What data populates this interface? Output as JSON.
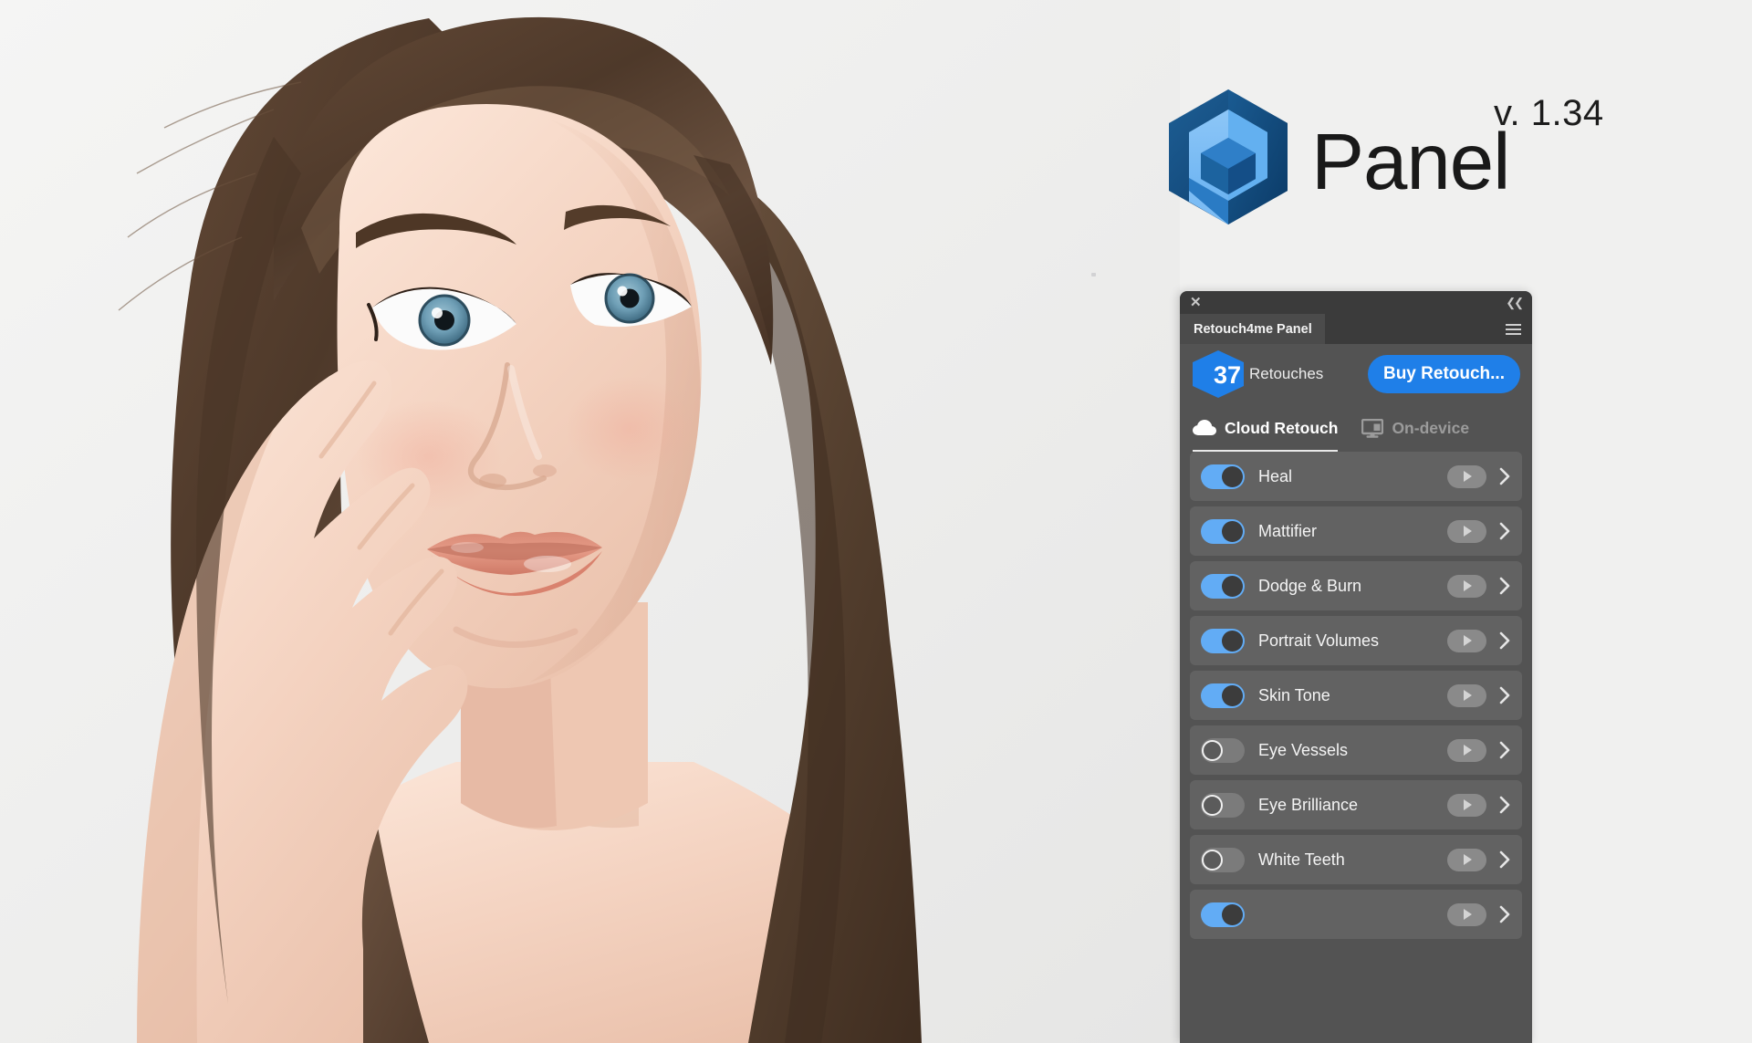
{
  "brand": {
    "name": "Panel",
    "version": "v. 1.34",
    "logo_icon": "hexagon-p-logo-icon"
  },
  "photo": {
    "alt": "portrait-photo-woman-retouched",
    "background_color": "#eeeeee"
  },
  "panel": {
    "titlebar": {
      "close_icon": "close-icon",
      "collapse_icon": "double-chevron-left-icon"
    },
    "tab": {
      "label": "Retouch4me Panel",
      "menu_icon": "hamburger-menu-icon"
    },
    "credits": {
      "count": "37",
      "label": "Retouches",
      "buy_button": "Buy Retouch..."
    },
    "mode_tabs": [
      {
        "label": "Cloud Retouch",
        "icon": "cloud-icon",
        "active": true
      },
      {
        "label": "On-device",
        "icon": "monitor-icon",
        "active": false
      }
    ],
    "features": [
      {
        "name": "Heal",
        "enabled": true
      },
      {
        "name": "Mattifier",
        "enabled": true
      },
      {
        "name": "Dodge & Burn",
        "enabled": true
      },
      {
        "name": "Portrait Volumes",
        "enabled": true
      },
      {
        "name": "Skin Tone",
        "enabled": true
      },
      {
        "name": "Eye Vessels",
        "enabled": false
      },
      {
        "name": "Eye Brilliance",
        "enabled": false
      },
      {
        "name": "White Teeth",
        "enabled": false
      },
      {
        "name": "",
        "enabled": true
      }
    ],
    "row_icons": {
      "play_icon": "play-icon",
      "expand_icon": "chevron-right-icon"
    }
  },
  "colors": {
    "accent_blue": "#1f7fe8",
    "toggle_on": "#62acf5",
    "panel_bg": "#535353",
    "row_bg": "#626262",
    "titlebar_bg": "#3b3b3b"
  }
}
